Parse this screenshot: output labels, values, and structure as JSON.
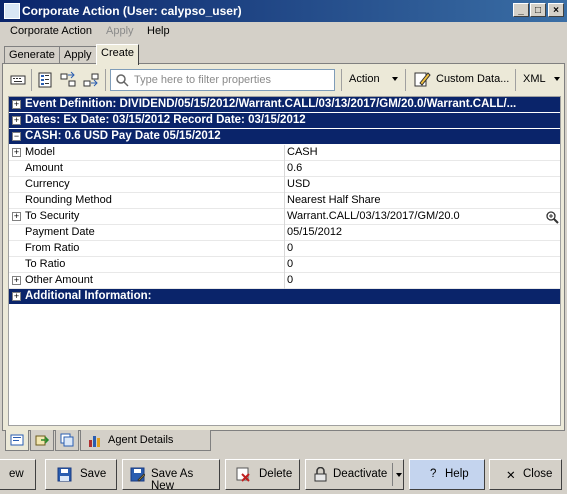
{
  "window": {
    "title": "Corporate Action (User: calypso_user)",
    "minimize": "_",
    "maximize": "□",
    "close": "×"
  },
  "menu": {
    "items": [
      "Corporate Action",
      "Apply",
      "Help"
    ]
  },
  "tabs": [
    "Generate",
    "Apply",
    "Create"
  ],
  "toolbar": {
    "filter_placeholder": "Type here to filter properties",
    "action_label": "Action",
    "custom_data_label": "Custom Data...",
    "xml_label": "XML"
  },
  "sections": {
    "event": "Event Definition: DIVIDEND/05/15/2012/Warrant.CALL/03/13/2017/GM/20.0/Warrant.CALL/...",
    "dates": "Dates:  Ex Date: 03/15/2012 Record Date: 03/15/2012",
    "cash": "CASH: 0.6  USD Pay Date 05/15/2012",
    "additional": "Additional Information:"
  },
  "properties": [
    {
      "key": "Model",
      "value": "CASH"
    },
    {
      "key": "Amount",
      "value": "0.6"
    },
    {
      "key": "Currency",
      "value": "USD"
    },
    {
      "key": "Rounding Method",
      "value": "Nearest Half Share"
    },
    {
      "key": "To Security",
      "value": "Warrant.CALL/03/13/2017/GM/20.0"
    },
    {
      "key": "Payment Date",
      "value": "05/15/2012"
    },
    {
      "key": "From Ratio",
      "value": "0"
    },
    {
      "key": "To Ratio",
      "value": "0"
    },
    {
      "key": "Other Amount",
      "value": "0"
    }
  ],
  "bottom_tabs": {
    "agent_details": "Agent Details"
  },
  "buttons": {
    "partial": "ew",
    "save": "Save",
    "save_as_new": "Save As New",
    "delete": "Delete",
    "deactivate": "Deactivate",
    "help": "Help",
    "close": "Close"
  },
  "colors": {
    "section_header_bg": "#0a246a",
    "title_gradient_start": "#0a246a",
    "title_gradient_end": "#3a6ea5"
  }
}
